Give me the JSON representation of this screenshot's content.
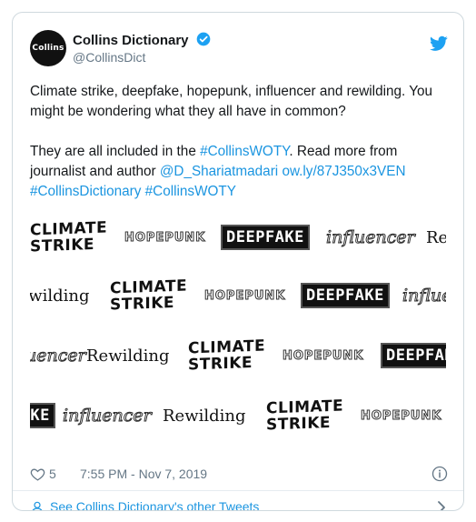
{
  "account": {
    "name": "Collins Dictionary",
    "handle": "@CollinsDict",
    "avatar_text": "Collins"
  },
  "tweet": {
    "line1": "Climate strike, deepfake, hopepunk, influencer and rewilding. You might be wondering what they all have in common?",
    "line2_prefix": "They are all included in the ",
    "hashtag_woty": "#CollinsWOTY",
    "line2_mid": ". Read more from journalist and author ",
    "mention": "@D_Shariatmadari",
    "link": "ow.ly/87J350x3VEN",
    "hashtag_dict": "#CollinsDictionary",
    "hashtag_woty2": "#CollinsWOTY"
  },
  "media": {
    "words": {
      "climate_line1": "CLIMATE",
      "climate_line2": "STRIKE",
      "hopepunk": "HOPEPUNK",
      "deepfake": "DEEPFAKE",
      "influencer": "influencer",
      "rewilding": "Rewilding"
    }
  },
  "footer": {
    "likes": "5",
    "timestamp": "7:55 PM - Nov 7, 2019"
  },
  "more_tweets": {
    "label": "See Collins Dictionary's other Tweets"
  },
  "colors": {
    "link": "#1b95e0",
    "verified": "#1da1f2",
    "text": "#14171a",
    "muted": "#657786"
  },
  "icons": [
    "verified-icon",
    "twitter-bird-icon",
    "heart-icon",
    "info-icon",
    "person-icon",
    "chevron-right-icon"
  ]
}
